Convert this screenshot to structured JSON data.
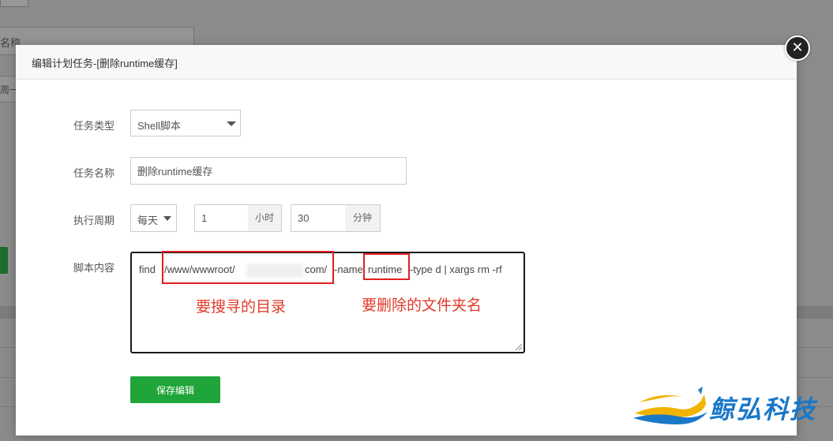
{
  "background": {
    "name_field_text": "名称",
    "week_select_text": "周一"
  },
  "modal": {
    "title": "编辑计划任务-[删除runtime缓存]",
    "close_icon": "close-icon"
  },
  "form": {
    "task_type": {
      "label": "任务类型",
      "value": "Shell脚本"
    },
    "task_name": {
      "label": "任务名称",
      "value": "删除runtime缓存"
    },
    "cycle": {
      "label": "执行周期",
      "period_value": "每天",
      "hour_value": "1",
      "hour_unit": "小时",
      "minute_value": "30",
      "minute_unit": "分钟"
    },
    "script": {
      "label": "脚本内容",
      "part_find": "find",
      "part_dir_start": "/www/wwwroot/",
      "part_dir_end": "com/",
      "part_name_flag": "-name",
      "part_folder": "runtime",
      "part_rest": "-type d  | xargs rm -rf"
    },
    "save_label": "保存编辑"
  },
  "annotations": {
    "dir_note": "要搜寻的目录",
    "folder_note": "要删除的文件夹名",
    "color": "#e02020"
  },
  "watermark": {
    "text": "鲸弘科技",
    "color": "#1a78c8",
    "accent": "#f0b400"
  }
}
